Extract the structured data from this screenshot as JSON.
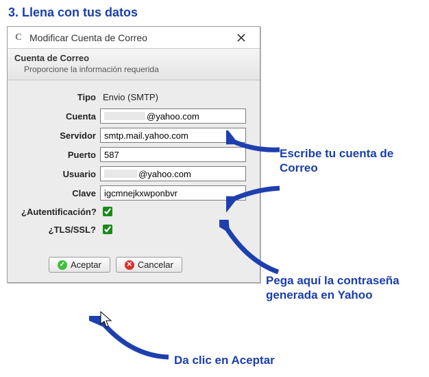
{
  "step_title": "3. Llena con tus datos",
  "dialog": {
    "title": "Modificar Cuenta de Correo",
    "section_title": "Cuenta de Correo",
    "section_sub": "Proporcione la información requerida"
  },
  "labels": {
    "tipo": "Tipo",
    "cuenta": "Cuenta",
    "servidor": "Servidor",
    "puerto": "Puerto",
    "usuario": "Usuario",
    "clave": "Clave",
    "auth": "¿Autentificación?",
    "tls": "¿TLS/SSL?"
  },
  "values": {
    "tipo": "Envio (SMTP)",
    "cuenta_suffix": "@yahoo.com",
    "servidor": "smtp.mail.yahoo.com",
    "puerto": "587",
    "usuario_suffix": "@yahoo.com",
    "clave": "igcmnejkxwponbvr",
    "auth_checked": true,
    "tls_checked": true
  },
  "buttons": {
    "accept": "Aceptar",
    "cancel": "Cancelar"
  },
  "annotations": {
    "cuenta_hint": "Escribe tu cuenta de Correo",
    "clave_hint": "Pega aquí la contraseña generada en Yahoo",
    "accept_hint": "Da clic en Aceptar"
  }
}
